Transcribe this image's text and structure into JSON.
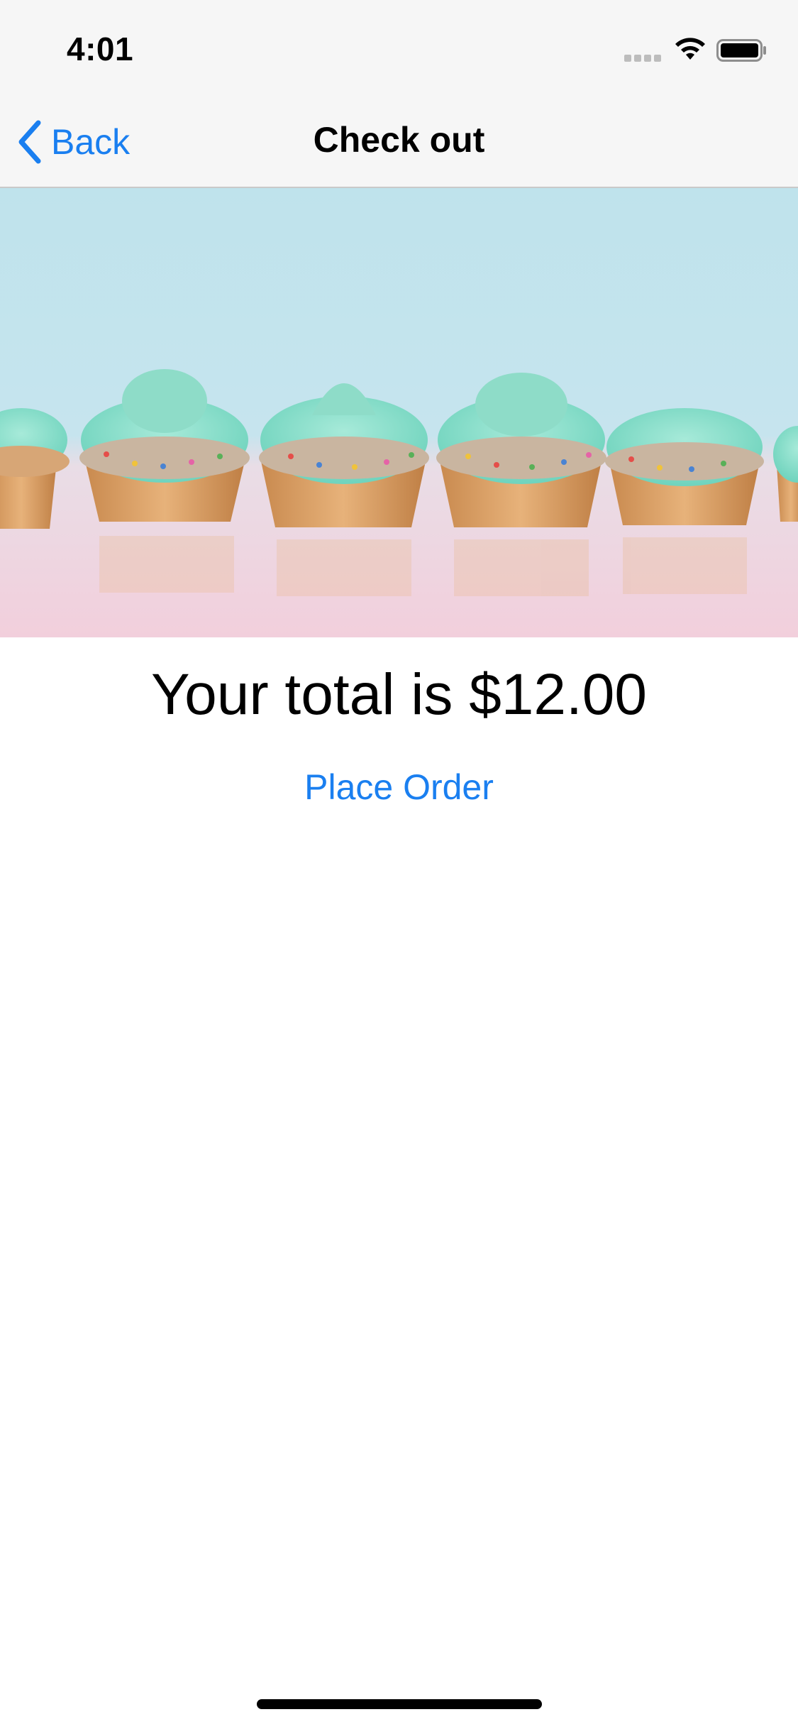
{
  "status_bar": {
    "time": "4:01",
    "icons": [
      "cellular-signal-icon",
      "wifi-icon",
      "battery-icon"
    ]
  },
  "nav_bar": {
    "back_label": "Back",
    "title": "Check out"
  },
  "hero_image": {
    "subject": "row of cupcakes with mint frosting and rainbow sprinkles"
  },
  "checkout": {
    "total_text": "Your total is $12.00",
    "place_order_label": "Place Order"
  },
  "colors": {
    "accent": "#1a7ff0",
    "nav_background": "#f6f6f6"
  }
}
